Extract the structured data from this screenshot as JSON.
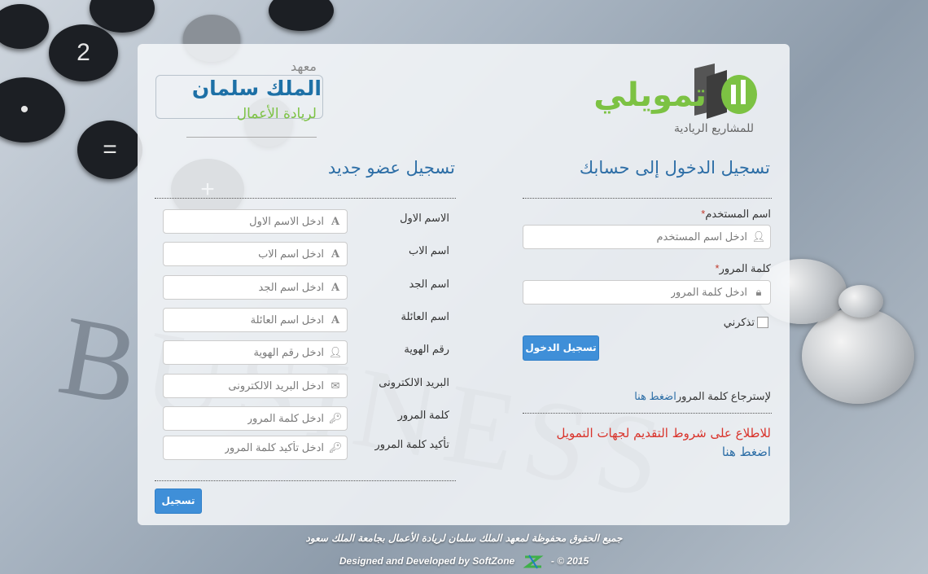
{
  "logos": {
    "tamweeli_name": "تمويلي",
    "tamweeli_tagline": "للمشاريع الريادية",
    "institute_top": "معهد",
    "institute_name": "الملك سلمان",
    "institute_sub": "لريادة الأعمال"
  },
  "login": {
    "title": "تسجيل الدخول إلى حسابك",
    "username_label": "اسم المستخدم",
    "username_placeholder": "ادخل اسم المستخدم",
    "password_label": "كلمة المرور",
    "password_placeholder": "ادخل كلمة المرور",
    "required_mark": "*",
    "remember_label": "تذكرني",
    "submit_label": "تسجيل الدخول",
    "forgot_text": "لإسترجاع كلمة المرور",
    "forgot_link": "اضغط هنا",
    "terms_text": "للاطلاع على شروط التقديم لجهات التمويل",
    "terms_link": "اضغط هنا"
  },
  "register": {
    "title": "تسجيل عضو جديد",
    "fields": [
      {
        "label": "الاسم الاول",
        "placeholder": "ادخل الاسم الاول",
        "icon": "font-icon"
      },
      {
        "label": "اسم الاب",
        "placeholder": "ادخل اسم الاب",
        "icon": "font-icon"
      },
      {
        "label": "اسم الجد",
        "placeholder": "ادخل اسم الجد",
        "icon": "font-icon"
      },
      {
        "label": "اسم العائلة",
        "placeholder": "ادخل اسم العائلة",
        "icon": "font-icon"
      },
      {
        "label": "رقم الهوية",
        "placeholder": "ادخل رقم الهوية",
        "icon": "user-icon"
      },
      {
        "label": "البريد الالكترونى",
        "placeholder": "ادخل البريد الالكترونى",
        "icon": "envelope-icon"
      },
      {
        "label": "كلمة المرور",
        "placeholder": "ادخل كلمة المرور",
        "icon": "key-icon"
      },
      {
        "label": "تأكيد كلمة المرور",
        "placeholder": "ادخل تأكيد كلمة المرور",
        "icon": "key-icon"
      }
    ],
    "submit_label": "تسجيل"
  },
  "footer": {
    "rights": "جميع الحقوق محفوظة لمعهد الملك سلمان لريادة الأعمال بجامعة الملك سعود",
    "credit": "Designed and Developed by SoftZone",
    "year": "- © 2015"
  },
  "colors": {
    "accent": "#2d6ea6",
    "button": "#3f8fd8",
    "terms_red": "#d9332b",
    "logo_green": "#7cc243"
  }
}
